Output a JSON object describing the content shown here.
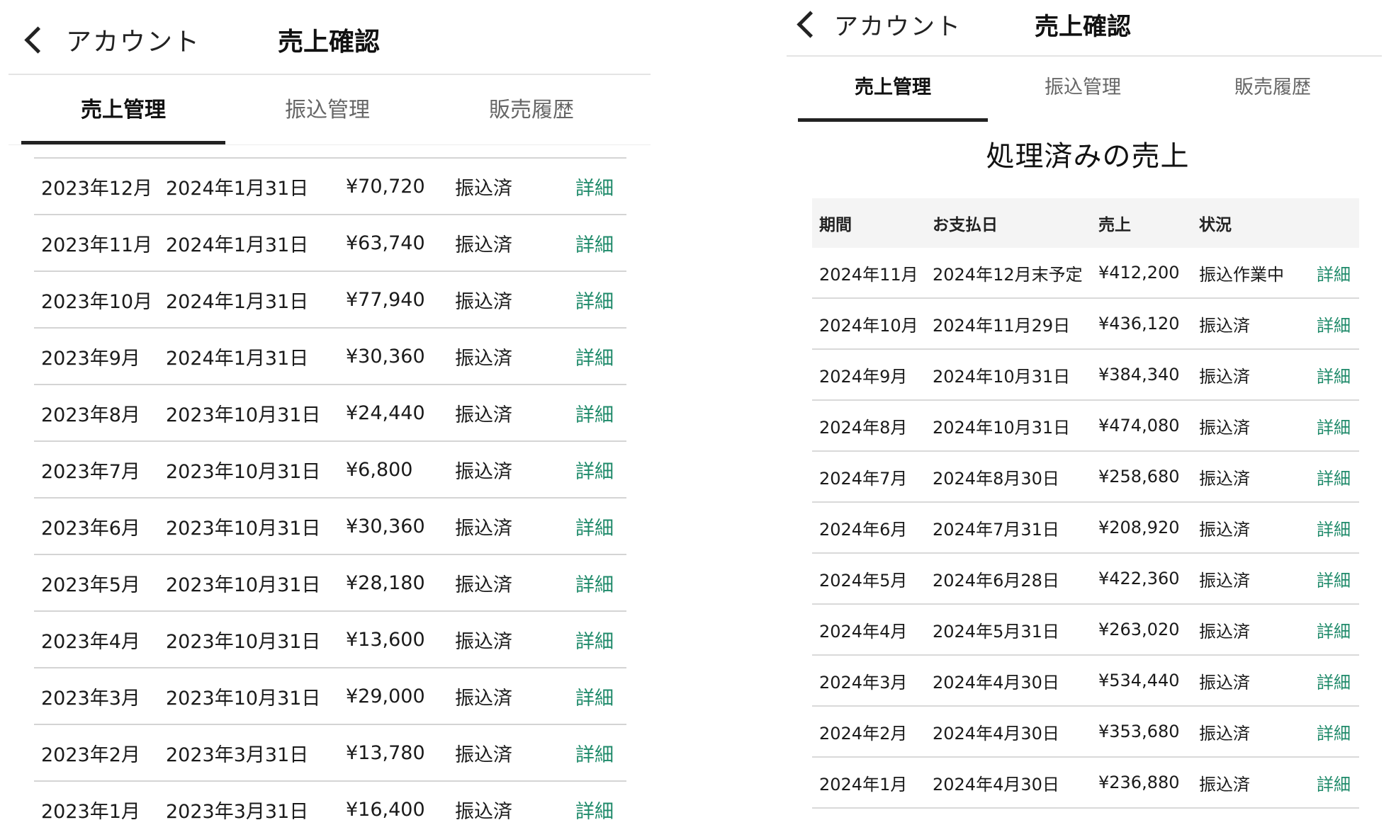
{
  "left": {
    "back_label": "アカウント",
    "title": "売上確認",
    "tabs": [
      {
        "label": "売上管理",
        "active": true
      },
      {
        "label": "振込管理",
        "active": false
      },
      {
        "label": "販売履歴",
        "active": false
      }
    ],
    "rows": [
      [
        "2023年12月",
        "2024年1月31日",
        "¥70,720",
        "振込済",
        "詳細"
      ],
      [
        "2023年11月",
        "2024年1月31日",
        "¥63,740",
        "振込済",
        "詳細"
      ],
      [
        "2023年10月",
        "2024年1月31日",
        "¥77,940",
        "振込済",
        "詳細"
      ],
      [
        "2023年9月",
        "2024年1月31日",
        "¥30,360",
        "振込済",
        "詳細"
      ],
      [
        "2023年8月",
        "2023年10月31日",
        "¥24,440",
        "振込済",
        "詳細"
      ],
      [
        "2023年7月",
        "2023年10月31日",
        "¥6,800",
        "振込済",
        "詳細"
      ],
      [
        "2023年6月",
        "2023年10月31日",
        "¥30,360",
        "振込済",
        "詳細"
      ],
      [
        "2023年5月",
        "2023年10月31日",
        "¥28,180",
        "振込済",
        "詳細"
      ],
      [
        "2023年4月",
        "2023年10月31日",
        "¥13,600",
        "振込済",
        "詳細"
      ],
      [
        "2023年3月",
        "2023年10月31日",
        "¥29,000",
        "振込済",
        "詳細"
      ],
      [
        "2023年2月",
        "2023年3月31日",
        "¥13,780",
        "振込済",
        "詳細"
      ],
      [
        "2023年1月",
        "2023年3月31日",
        "¥16,400",
        "振込済",
        "詳細"
      ]
    ]
  },
  "right": {
    "back_label": "アカウント",
    "title": "売上確認",
    "tabs": [
      {
        "label": "売上管理",
        "active": true
      },
      {
        "label": "振込管理",
        "active": false
      },
      {
        "label": "販売履歴",
        "active": false
      }
    ],
    "section_title": "処理済みの売上",
    "columns": [
      "期間",
      "お支払日",
      "売上",
      "状況",
      ""
    ],
    "rows": [
      [
        "2024年11月",
        "2024年12月末予定",
        "¥412,200",
        "振込作業中",
        "詳細"
      ],
      [
        "2024年10月",
        "2024年11月29日",
        "¥436,120",
        "振込済",
        "詳細"
      ],
      [
        "2024年9月",
        "2024年10月31日",
        "¥384,340",
        "振込済",
        "詳細"
      ],
      [
        "2024年8月",
        "2024年10月31日",
        "¥474,080",
        "振込済",
        "詳細"
      ],
      [
        "2024年7月",
        "2024年8月30日",
        "¥258,680",
        "振込済",
        "詳細"
      ],
      [
        "2024年6月",
        "2024年7月31日",
        "¥208,920",
        "振込済",
        "詳細"
      ],
      [
        "2024年5月",
        "2024年6月28日",
        "¥422,360",
        "振込済",
        "詳細"
      ],
      [
        "2024年4月",
        "2024年5月31日",
        "¥263,020",
        "振込済",
        "詳細"
      ],
      [
        "2024年3月",
        "2024年4月30日",
        "¥534,440",
        "振込済",
        "詳細"
      ],
      [
        "2024年2月",
        "2024年4月30日",
        "¥353,680",
        "振込済",
        "詳細"
      ],
      [
        "2024年1月",
        "2024年4月30日",
        "¥236,880",
        "振込済",
        "詳細"
      ]
    ]
  },
  "colors": {
    "link": "#1f8a6a",
    "text": "#1a1a1a",
    "tab_indicator": "#222222"
  },
  "icons": {
    "back": "chevron-left-icon"
  }
}
